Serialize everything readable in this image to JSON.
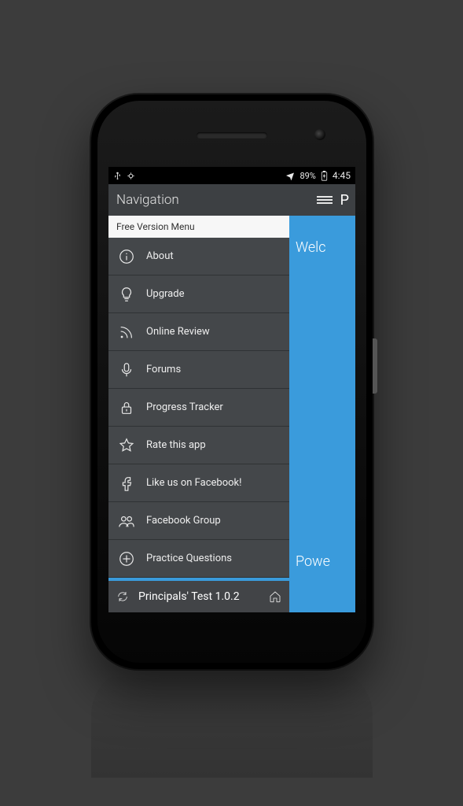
{
  "statusbar": {
    "battery_pct": "89%",
    "time": "4:45"
  },
  "appbar": {
    "title": "Navigation",
    "trailing_letter": "P"
  },
  "drawer": {
    "section_header": "Free Version Menu",
    "items": [
      {
        "icon": "info-icon",
        "label": "About"
      },
      {
        "icon": "bulb-icon",
        "label": "Upgrade"
      },
      {
        "icon": "rss-icon",
        "label": "Online Review"
      },
      {
        "icon": "mic-icon",
        "label": "Forums"
      },
      {
        "icon": "lock-icon",
        "label": "Progress Tracker"
      },
      {
        "icon": "star-icon",
        "label": "Rate this app"
      },
      {
        "icon": "facebook-icon",
        "label": "Like us on Facebook!"
      },
      {
        "icon": "group-icon",
        "label": "Facebook Group"
      },
      {
        "icon": "plus-circle-icon",
        "label": "Practice Questions"
      }
    ],
    "footer": {
      "title": "Principals' Test 1.0.2"
    }
  },
  "main": {
    "welcome_fragment": "Welc",
    "powered_fragment": "Powe"
  }
}
